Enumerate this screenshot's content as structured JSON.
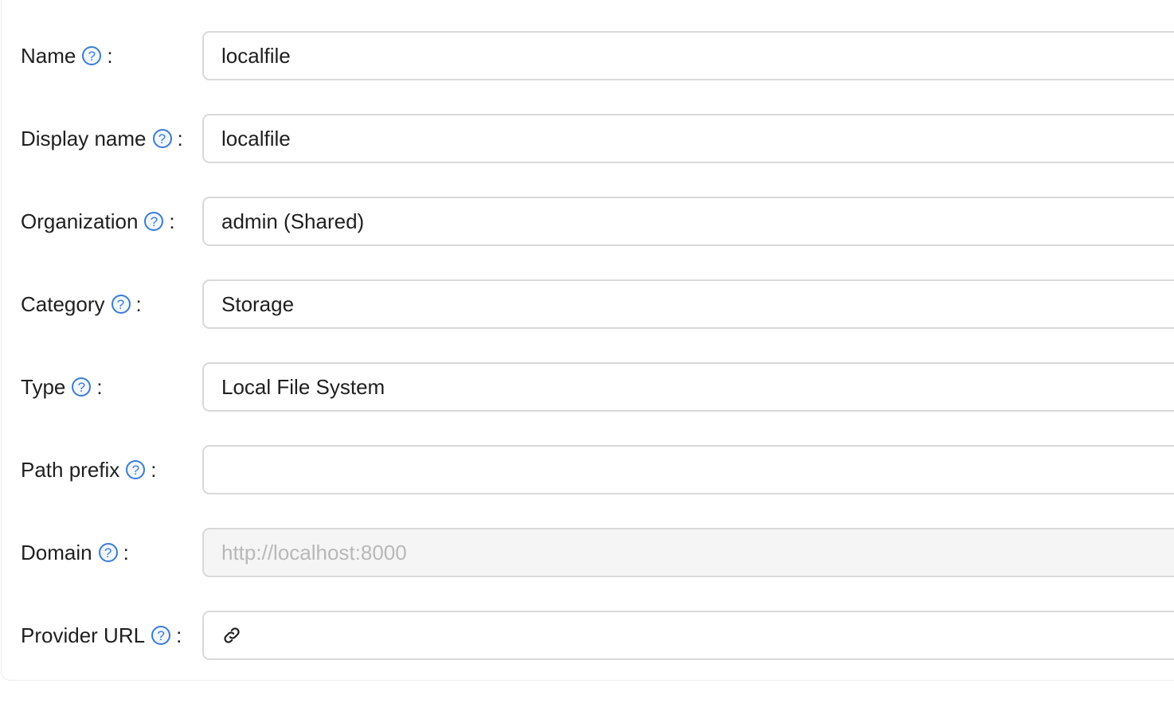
{
  "form": {
    "fields": [
      {
        "label": "Name",
        "value": "localfile",
        "help_icon": "question-circle-icon"
      },
      {
        "label": "Display name",
        "value": "localfile",
        "help_icon": "question-circle-icon"
      },
      {
        "label": "Organization",
        "value": "admin (Shared)",
        "help_icon": "question-circle-icon"
      },
      {
        "label": "Category",
        "value": "Storage",
        "help_icon": "question-circle-icon"
      },
      {
        "label": "Type",
        "value": "Local File System",
        "help_icon": "question-circle-icon"
      },
      {
        "label": "Path prefix",
        "value": "",
        "help_icon": "question-circle-icon"
      },
      {
        "label": "Domain",
        "value": "http://localhost:8000",
        "disabled": true,
        "help_icon": "question-circle-icon"
      },
      {
        "label": "Provider URL",
        "value": "",
        "prefix_icon": "link-icon",
        "help_icon": "question-circle-icon"
      }
    ],
    "help_glyph": "?",
    "colon": ":"
  }
}
